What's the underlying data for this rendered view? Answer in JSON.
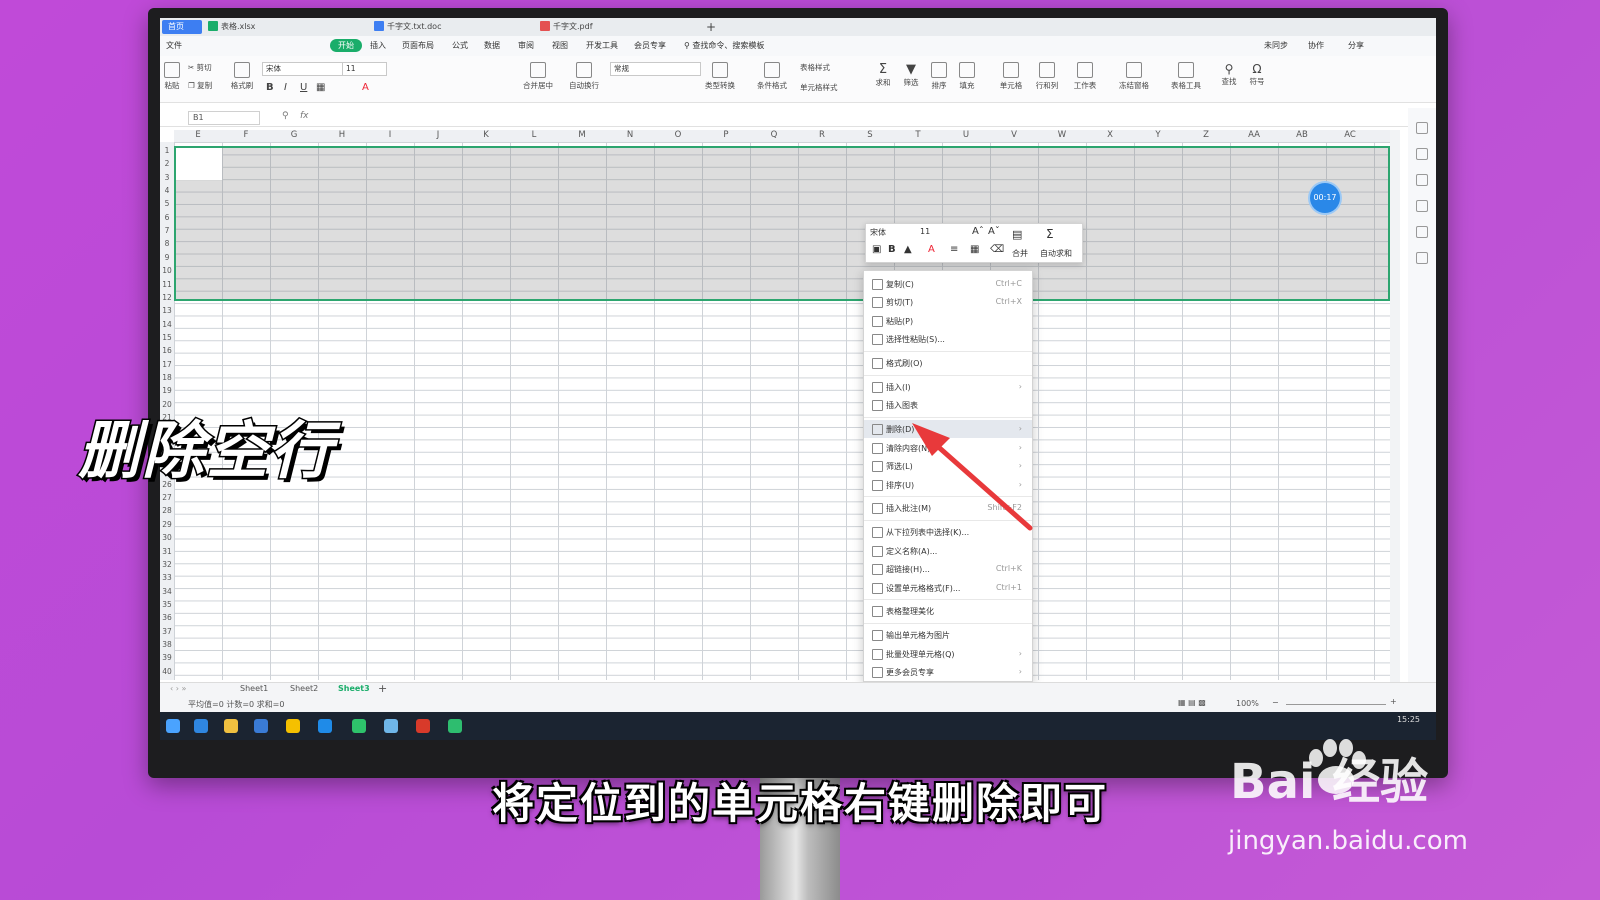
{
  "tabs": {
    "home": "首页",
    "t1": "表格.xlsx",
    "t2": "千字文.txt.doc",
    "t3": "千字文.pdf",
    "add": "+"
  },
  "menu": [
    "文件",
    "开始",
    "插入",
    "页面布局",
    "公式",
    "数据",
    "审阅",
    "视图",
    "开发工具",
    "会员专享"
  ],
  "menu_search": "查找命令、搜索模板",
  "menu_right": [
    "未同步",
    "协作",
    "分享"
  ],
  "ribbon": {
    "paste": "粘贴",
    "cut": "剪切",
    "copy": "复制",
    "format_painter": "格式刷",
    "font": "宋体",
    "size": "11",
    "number_format": "常规",
    "merge": "合并居中",
    "wrap": "自动换行",
    "convert": "类型转换",
    "cond": "条件格式",
    "table_style": "表格样式",
    "cell_style": "单元格样式",
    "sum": "求和",
    "filter": "筛选",
    "sort": "排序",
    "fill": "填充",
    "cell": "单元格",
    "rowcol": "行和列",
    "sheet": "工作表",
    "freeze": "冻结窗格",
    "tools": "表格工具",
    "find": "查找",
    "symbol": "符号"
  },
  "formula": {
    "cell": "B1",
    "fx": "fx"
  },
  "columns": [
    "E",
    "F",
    "G",
    "H",
    "I",
    "J",
    "K",
    "L",
    "M",
    "N",
    "O",
    "P",
    "Q",
    "R",
    "S",
    "T",
    "U",
    "V",
    "W",
    "X",
    "Y",
    "Z",
    "AA",
    "AB",
    "AC"
  ],
  "rows": [
    "1",
    "2",
    "3",
    "4",
    "5",
    "6",
    "7",
    "8",
    "9",
    "10",
    "11",
    "12",
    "13",
    "14",
    "15",
    "16",
    "17",
    "18",
    "19",
    "20",
    "21",
    "22",
    "23",
    "24",
    "25",
    "26",
    "27",
    "28",
    "29",
    "30",
    "31",
    "32",
    "33",
    "34",
    "35",
    "36",
    "37",
    "38",
    "39",
    "40"
  ],
  "mini_toolbar": {
    "font": "宋体",
    "size": "11",
    "merge": "合并",
    "autosum": "自动求和"
  },
  "context_menu": [
    {
      "label": "复制(C)",
      "shortcut": "Ctrl+C"
    },
    {
      "label": "剪切(T)",
      "shortcut": "Ctrl+X"
    },
    {
      "label": "粘贴(P)",
      "shortcut": ""
    },
    {
      "label": "选择性粘贴(S)...",
      "shortcut": ""
    },
    {
      "label": "格式刷(O)",
      "shortcut": ""
    },
    {
      "label": "插入(I)",
      "shortcut": "›"
    },
    {
      "label": "插入图表",
      "shortcut": ""
    },
    {
      "label": "删除(D)",
      "shortcut": "›"
    },
    {
      "label": "清除内容(N)",
      "shortcut": "›"
    },
    {
      "label": "筛选(L)",
      "shortcut": "›"
    },
    {
      "label": "排序(U)",
      "shortcut": "›"
    },
    {
      "label": "插入批注(M)",
      "shortcut": "Shift+F2"
    },
    {
      "label": "从下拉列表中选择(K)...",
      "shortcut": ""
    },
    {
      "label": "定义名称(A)...",
      "shortcut": ""
    },
    {
      "label": "超链接(H)...",
      "shortcut": "Ctrl+K"
    },
    {
      "label": "设置单元格格式(F)...",
      "shortcut": "Ctrl+1"
    },
    {
      "label": "表格整理美化",
      "shortcut": ""
    },
    {
      "label": "输出单元格为图片",
      "shortcut": ""
    },
    {
      "label": "批量处理单元格(Q)",
      "shortcut": "›"
    },
    {
      "label": "更多会员专享",
      "shortcut": "›"
    }
  ],
  "sheets": [
    "Sheet1",
    "Sheet2",
    "Sheet3"
  ],
  "status": {
    "summary": "平均值=0  计数=0  求和=0",
    "zoom": "100%"
  },
  "clock": "15:25",
  "timer": "00:17",
  "overlay_title": "删除空行",
  "subtitle": "将定位到的单元格右键删除即可",
  "watermark": {
    "logo": "Bai 经验",
    "url": "jingyan.baidu.com"
  },
  "colors": {
    "accent": "#1aad6a",
    "selection_border": "#2da56f",
    "arrow": "#e8393b",
    "background": "#c04ad8"
  }
}
